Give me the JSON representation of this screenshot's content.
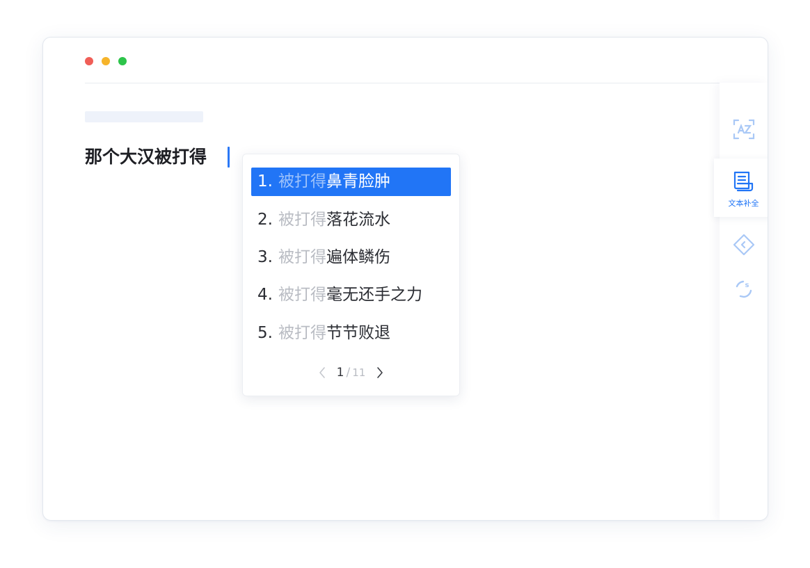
{
  "window": {
    "traffic_lights": [
      {
        "name": "close",
        "color": "#f05e57"
      },
      {
        "name": "minimize",
        "color": "#f6b42b"
      },
      {
        "name": "maximize",
        "color": "#2dc44a"
      }
    ]
  },
  "editor": {
    "text": "那个大汉被打得"
  },
  "suggestions": {
    "items": [
      {
        "number": "1.",
        "prefix": "被打得",
        "completion": "鼻青脸肿",
        "selected": true
      },
      {
        "number": "2.",
        "prefix": "被打得",
        "completion": "落花流水",
        "selected": false
      },
      {
        "number": "3.",
        "prefix": "被打得",
        "completion": "遍体鳞伤",
        "selected": false
      },
      {
        "number": "4.",
        "prefix": "被打得",
        "completion": "毫无还手之力",
        "selected": false
      },
      {
        "number": "5.",
        "prefix": "被打得",
        "completion": "节节败退",
        "selected": false
      }
    ],
    "pager": {
      "current": "1",
      "separator": "/",
      "total": "11"
    }
  },
  "sidebar": {
    "items": [
      {
        "icon": "text-recognition-icon",
        "label": "",
        "active": false
      },
      {
        "icon": "document-icon",
        "label": "文本补全",
        "active": true
      },
      {
        "icon": "diamond-code-icon",
        "label": "",
        "active": false
      },
      {
        "icon": "refresh-s-icon",
        "label": "",
        "active": false
      }
    ]
  },
  "colors": {
    "accent": "#2175f6",
    "icon_light": "#a9c8f6",
    "muted_text": "#b9bcc3"
  }
}
